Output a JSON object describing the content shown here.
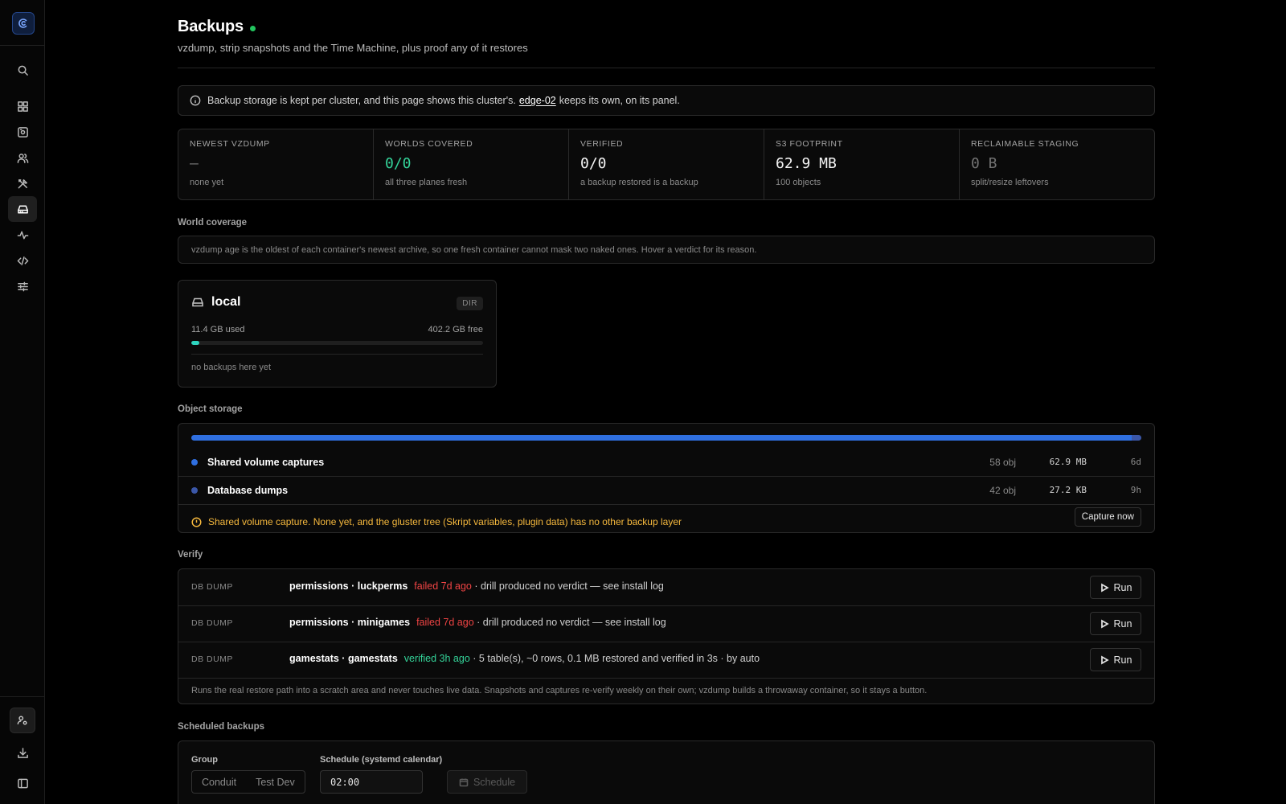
{
  "page": {
    "title": "Backups",
    "subtitle": "vzdump, strip snapshots and the Time Machine, plus proof any of it restores"
  },
  "sidebar": {
    "items": [
      {
        "icon": "search-icon"
      },
      {
        "icon": "dashboard-icon"
      },
      {
        "icon": "server-icon"
      },
      {
        "icon": "users-icon"
      },
      {
        "icon": "tools-icon"
      },
      {
        "icon": "hard-drive-icon",
        "active": true
      },
      {
        "icon": "activity-icon"
      },
      {
        "icon": "code-icon"
      },
      {
        "icon": "sliders-icon"
      }
    ],
    "bottom": [
      {
        "icon": "user-cog-icon"
      },
      {
        "icon": "download-icon"
      },
      {
        "icon": "sidebar-toggle-icon"
      }
    ]
  },
  "notice": {
    "before": "Backup storage is kept per cluster, and this page shows this cluster's.",
    "link": "edge-02",
    "after": "keeps its own, on its panel."
  },
  "stats": [
    {
      "label": "NEWEST VZDUMP",
      "value": "—",
      "sub": "none yet"
    },
    {
      "label": "WORLDS COVERED",
      "value": "0/0",
      "sub": "all three planes fresh"
    },
    {
      "label": "VERIFIED",
      "value": "0/0",
      "sub": "a backup restored is a backup"
    },
    {
      "label": "S3 FOOTPRINT",
      "value": "62.9 MB",
      "sub": "100 objects"
    },
    {
      "label": "RECLAIMABLE STAGING",
      "value": "0 B",
      "sub": "split/resize leftovers"
    }
  ],
  "coverage": {
    "label": "World coverage",
    "note": "vzdump age is the oldest of each container's newest archive, so one fresh container cannot mask two naked ones. Hover a verdict for its reason."
  },
  "local": {
    "name": "local",
    "badge": "DIR",
    "used": "11.4 GB used",
    "free": "402.2 GB free",
    "used_fraction": 0.028,
    "empty": "no backups here yet"
  },
  "object_storage": {
    "label": "Object storage",
    "rows": [
      {
        "name": "Shared volume captures",
        "count": "58 obj",
        "size": "62.9 MB",
        "age": "6d",
        "color": "#2f6fe0",
        "share": 0.99
      },
      {
        "name": "Database dumps",
        "count": "42 obj",
        "size": "27.2 KB",
        "age": "9h",
        "color": "#3b57a8",
        "share": 0.01
      }
    ],
    "warning": "Shared volume capture. None yet, and the gluster tree (Skript variables, plugin data) has no other backup layer",
    "capture_label": "Capture now"
  },
  "verify": {
    "label": "Verify",
    "rows": [
      {
        "type": "DB DUMP",
        "name": "permissions · luckperms",
        "status": "failed 7d ago",
        "state": "failed",
        "detail": "· drill produced no verdict — see install log",
        "run": "Run"
      },
      {
        "type": "DB DUMP",
        "name": "permissions · minigames",
        "status": "failed 7d ago",
        "state": "failed",
        "detail": "· drill produced no verdict — see install log",
        "run": "Run"
      },
      {
        "type": "DB DUMP",
        "name": "gamestats · gamestats",
        "status": "verified 3h ago",
        "state": "ok",
        "detail": "· 5 table(s), ~0 rows, 0.1 MB restored and verified in 3s · by auto",
        "run": "Run"
      }
    ],
    "footer": "Runs the real restore path into a scratch area and never touches live data. Snapshots and captures re-verify weekly on their own; vzdump builds a throwaway container, so it stays a button."
  },
  "scheduled": {
    "label": "Scheduled backups",
    "group_label": "Group",
    "groups": [
      "Conduit",
      "Test Dev"
    ],
    "calendar_label": "Schedule (systemd calendar)",
    "calendar_value": "02:00",
    "schedule_button": "Schedule"
  }
}
